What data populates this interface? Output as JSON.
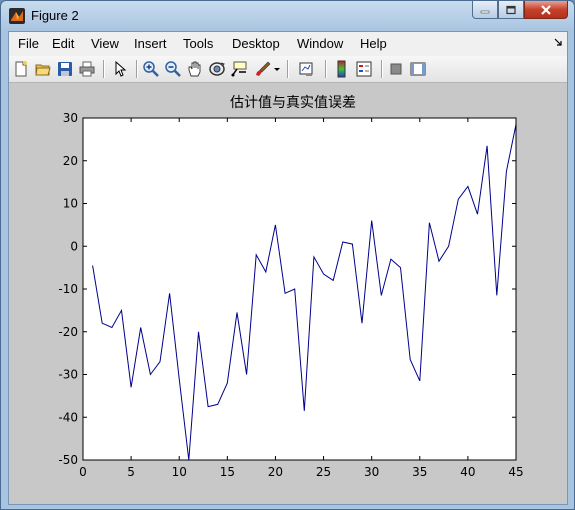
{
  "window": {
    "title": "Figure 2",
    "controls": {
      "minimize_icon": "minimize-icon",
      "maximize_icon": "maximize-icon",
      "close_icon": "close-icon"
    }
  },
  "menu": {
    "items": [
      "File",
      "Edit",
      "View",
      "Insert",
      "Tools",
      "Desktop",
      "Window",
      "Help"
    ],
    "overflow_icon": "dock-arrow-icon"
  },
  "toolbar": {
    "buttons": [
      "new-figure-icon",
      "open-file-icon",
      "save-icon",
      "print-icon",
      "pointer-icon",
      "zoom-in-icon",
      "zoom-out-icon",
      "pan-icon",
      "rotate-3d-icon",
      "data-cursor-icon",
      "brush-icon",
      "link-plot-icon",
      "colorbar-icon",
      "legend-icon",
      "hide-plot-tools-icon",
      "show-plot-tools-icon"
    ]
  },
  "colors": {
    "figure_bg": "#c8c8c8",
    "axes_bg": "#ffffff",
    "line": "#00008b"
  },
  "chart_data": {
    "type": "line",
    "title": "估计值与真实值误差",
    "xlabel": "",
    "ylabel": "",
    "xlim": [
      0,
      45
    ],
    "ylim": [
      -50,
      30
    ],
    "xticks": [
      0,
      5,
      10,
      15,
      20,
      25,
      30,
      35,
      40,
      45
    ],
    "yticks": [
      -50,
      -40,
      -30,
      -20,
      -10,
      0,
      10,
      20,
      30
    ],
    "grid": false,
    "series": [
      {
        "x": [
          1,
          2,
          3,
          4,
          5,
          6,
          7,
          8,
          9,
          10,
          11,
          12,
          13,
          14,
          15,
          16,
          17,
          18,
          19,
          20,
          21,
          22,
          23,
          24,
          25,
          26,
          27,
          28,
          29,
          30,
          31,
          32,
          33,
          34,
          35,
          36,
          37,
          38,
          39,
          40,
          41,
          42,
          43,
          44,
          45
        ],
        "values": [
          -4.5,
          -18,
          -19,
          -15,
          -33,
          -19,
          -30,
          -27,
          -11,
          -31,
          -50,
          -20,
          -37.5,
          -37,
          -32,
          -15.5,
          -30,
          -2,
          -6,
          5,
          -11,
          -10,
          -38.5,
          -2.5,
          -6.5,
          -8,
          1,
          0.5,
          -18,
          6,
          -11.5,
          -3,
          -5,
          -26.5,
          -31.5,
          5.5,
          -3.5,
          0,
          11,
          14,
          7.5,
          23.5,
          -11.5,
          17.5,
          28.5
        ]
      }
    ]
  }
}
